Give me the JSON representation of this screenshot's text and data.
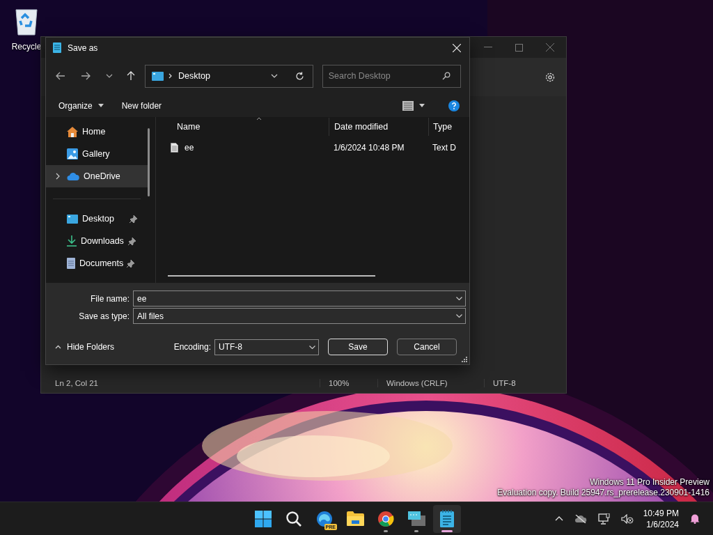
{
  "desktop_icons": [
    {
      "label": "Recycle"
    }
  ],
  "notepad_window": {
    "status_bar": [
      "Ln 2, Col 21",
      "100%",
      "Windows (CRLF)",
      "UTF-8"
    ]
  },
  "save_dialog": {
    "title": "Save as",
    "breadcrumb": "Desktop",
    "search": {
      "placeholder": "Search Desktop"
    },
    "toolbar": {
      "organize": "Organize",
      "new_folder": "New folder"
    },
    "nav_top": [
      {
        "label": "Home",
        "expandable": false,
        "selected": false
      },
      {
        "label": "Gallery",
        "expandable": false,
        "selected": false
      },
      {
        "label": "OneDrive",
        "expandable": true,
        "selected": true
      }
    ],
    "quick_access": [
      {
        "label": "Desktop",
        "pinned": true
      },
      {
        "label": "Downloads",
        "pinned": true
      },
      {
        "label": "Documents",
        "pinned": true
      }
    ],
    "columns": [
      "Name",
      "Date modified",
      "Type"
    ],
    "files": [
      {
        "name": "ee",
        "date": "1/6/2024 10:48 PM",
        "type": "Text D"
      }
    ],
    "file_name": {
      "label": "File name:",
      "value": "ee"
    },
    "save_type": {
      "label": "Save as type:",
      "value": "All files"
    },
    "hide_folders": "Hide Folders",
    "encoding": {
      "label": "Encoding:",
      "value": "UTF-8"
    },
    "buttons": [
      {
        "label": "Save",
        "default": true
      },
      {
        "label": "Cancel",
        "default": false
      }
    ]
  },
  "build_info": [
    "Windows 11 Pro Insider Preview",
    "Evaluation copy. Build 25947.rs_prerelease.230901-1416"
  ],
  "taskbar": {
    "apps": [
      {
        "kind": "start",
        "running": false,
        "active": false
      },
      {
        "kind": "search",
        "running": false,
        "active": false
      },
      {
        "kind": "edge",
        "running": false,
        "active": false,
        "badge": "PRE"
      },
      {
        "kind": "explorer",
        "running": false,
        "active": false
      },
      {
        "kind": "chrome",
        "running": true,
        "active": false
      },
      {
        "kind": "remote",
        "running": true,
        "active": false
      },
      {
        "kind": "notepad",
        "running": true,
        "active": true
      }
    ],
    "clock": {
      "time": "10:49 PM",
      "date": "1/6/2024"
    }
  }
}
